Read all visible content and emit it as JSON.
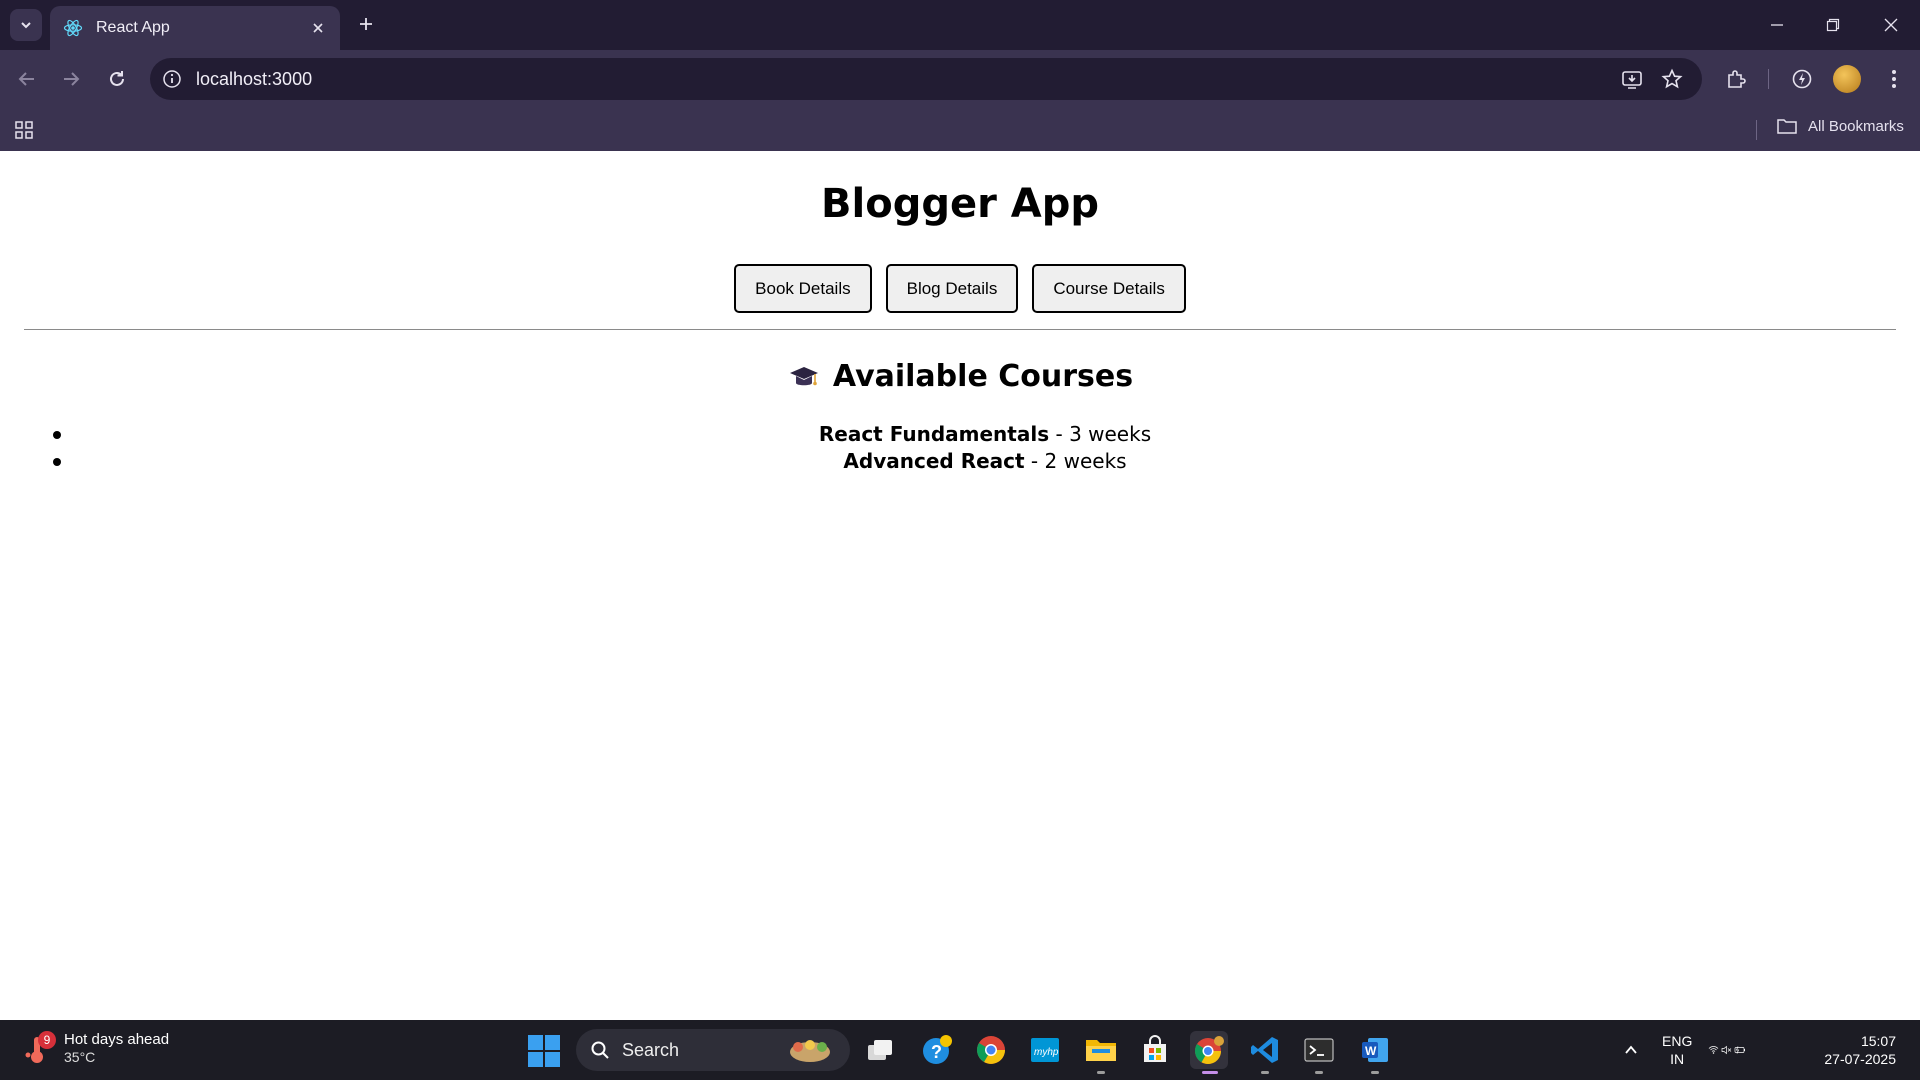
{
  "browser": {
    "tab_title": "React App",
    "url": "localhost:3000",
    "bookmarks_label": "All Bookmarks"
  },
  "page": {
    "title": "Blogger App",
    "buttons": [
      "Book Details",
      "Blog Details",
      "Course Details"
    ],
    "section_title": "Available Courses",
    "section_icon": "graduation-cap-icon",
    "courses": [
      {
        "name": "React Fundamentals",
        "duration": "3 weeks"
      },
      {
        "name": "Advanced React",
        "duration": "2 weeks"
      }
    ],
    "separator": " - "
  },
  "taskbar": {
    "weather_title": "Hot days ahead",
    "weather_temp": "35°C",
    "weather_badge": "9",
    "search_label": "Search",
    "lang_line1": "ENG",
    "lang_line2": "IN",
    "time": "15:07",
    "date": "27-07-2025"
  },
  "colors": {
    "chrome_dark": "#221c33",
    "chrome_mid": "#3a3350",
    "taskbar": "#1c1c24",
    "windows_blue": "#3aa0f0"
  }
}
